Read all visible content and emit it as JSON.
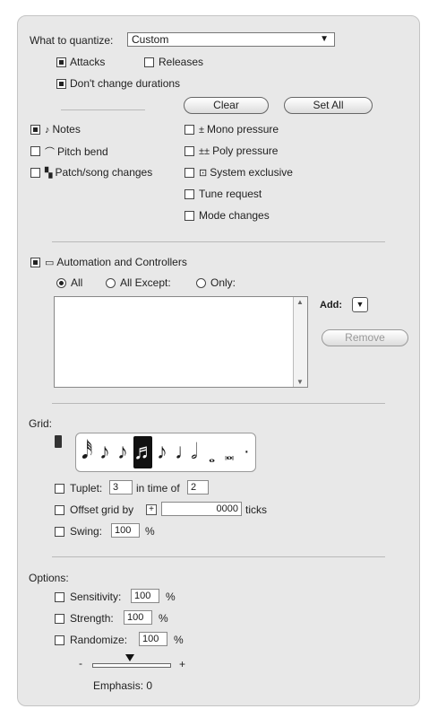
{
  "quantize": {
    "label": "What to quantize:",
    "select_value": "Custom",
    "attacks": "Attacks",
    "releases": "Releases",
    "dont_change": "Don't change durations",
    "clear": "Clear",
    "set_all": "Set All"
  },
  "events": {
    "notes": "Notes",
    "pitch_bend": "Pitch bend",
    "patch": "Patch/song changes",
    "mono": "Mono pressure",
    "poly": "Poly pressure",
    "sysex": "System exclusive",
    "tune": "Tune request",
    "mode": "Mode changes"
  },
  "automation": {
    "label": "Automation and Controllers",
    "all": "All",
    "all_except": "All Except:",
    "only": "Only:",
    "add": "Add:",
    "remove": "Remove"
  },
  "grid": {
    "label": "Grid:",
    "tuplet_label": "Tuplet:",
    "tuplet_value": "3",
    "in_time_of": "in time of",
    "in_time_value": "2",
    "offset_label": "Offset grid by",
    "offset_value": "0000",
    "ticks": "ticks",
    "swing_label": "Swing:",
    "swing_value": "100",
    "percent": "%"
  },
  "options": {
    "label": "Options:",
    "sensitivity_label": "Sensitivity:",
    "sensitivity_value": "100",
    "strength_label": "Strength:",
    "strength_value": "100",
    "randomize_label": "Randomize:",
    "randomize_value": "100",
    "percent": "%",
    "minus": "-",
    "plus": "+",
    "emphasis": "Emphasis: 0"
  }
}
